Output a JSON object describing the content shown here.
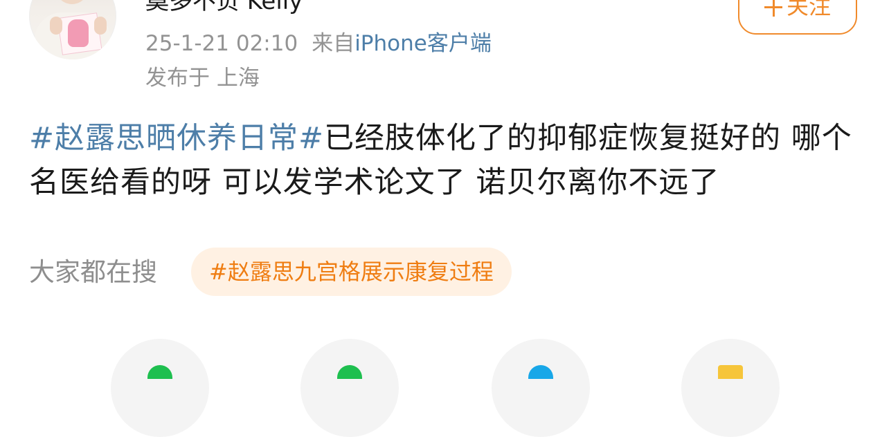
{
  "author": {
    "name": "奠多不负 Kelly",
    "follow_label": "关注"
  },
  "meta": {
    "timestamp": "25-1-21 02:10",
    "source_prefix": "来自",
    "source_name": "iPhone客户端",
    "location": "发布于 上海"
  },
  "post": {
    "hashtag": "#赵露思晒休养日常#",
    "text": "已经肢体化了的抑郁症恢复挺好的 哪个名医给看的呀 可以发学术论文了 诺贝尔离你不远了"
  },
  "trending": {
    "label": "大家都在搜",
    "topic": "#赵露思九宫格展示康复过程"
  },
  "share_targets": [
    {
      "icon": "wechat-session-icon",
      "color": "#1ebf4f"
    },
    {
      "icon": "wechat-moments-icon",
      "color": "#1ebf4f"
    },
    {
      "icon": "qq-icon",
      "color": "#18a7e8"
    },
    {
      "icon": "favorite-icon",
      "color": "#f6c53a"
    }
  ],
  "colors": {
    "link_blue": "#4d7ea8",
    "accent_orange": "#f08a2b",
    "chip_bg": "#fff1e3",
    "muted_gray": "#939393"
  }
}
